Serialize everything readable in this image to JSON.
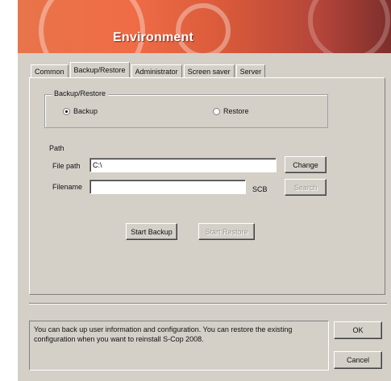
{
  "window": {
    "title": "Environment"
  },
  "tabs": [
    {
      "label": "Common"
    },
    {
      "label": "Backup/Restore"
    },
    {
      "label": "Administrator"
    },
    {
      "label": "Screen saver"
    },
    {
      "label": "Server"
    }
  ],
  "active_tab": "Backup/Restore",
  "backup_restore": {
    "group_title": "Backup/Restore",
    "backup_label": "Backup",
    "restore_label": "Restore",
    "selected": "Backup"
  },
  "path": {
    "group_title": "Path",
    "file_path_label": "File path",
    "file_path_value": "C:\\",
    "change_label": "Change",
    "filename_label": "Filename",
    "filename_value": "",
    "extension": "SCB",
    "search_label": "Search"
  },
  "actions": {
    "start_backup_label": "Start Backup",
    "start_restore_label": "Start Restore"
  },
  "info_text": "You can back up user information and configuration. You can restore the existing configuration when you want to reinstall S-Cop 2008.",
  "footer": {
    "ok_label": "OK",
    "cancel_label": "Cancel"
  },
  "colors": {
    "banner": "#e8744a",
    "dialog_bg": "#d4d0c8"
  }
}
